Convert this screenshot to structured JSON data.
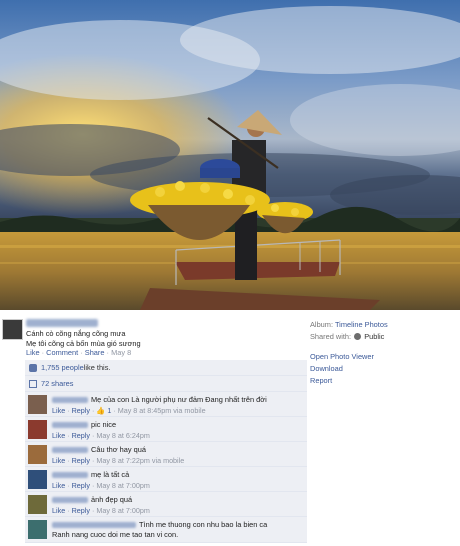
{
  "post": {
    "caption_lines": [
      "Cánh cò cõng nắng cõng mưa",
      "Mẹ tôi cõng cả bốn mùa gió sương"
    ],
    "actions": {
      "like": "Like",
      "comment": "Comment",
      "share": "Share",
      "date": "May 8"
    },
    "likes_text": "1,755 people",
    "likes_suffix": " like this.",
    "shares_text": "72 shares"
  },
  "sidebar": {
    "album_label": "Album:",
    "album_value": "Timeline Photos",
    "shared_label": "Shared with:",
    "shared_value": "Public",
    "menu": [
      "Open Photo Viewer",
      "Download",
      "Report"
    ]
  },
  "comments": [
    {
      "text": "Mẹ của con Là người phụ nư đảm Đang nhất trên đời",
      "like": "Like",
      "reply": "Reply",
      "likes": "1",
      "meta": "May 8 at 8:45pm via mobile",
      "avatar_color": "#7a5f4e"
    },
    {
      "text": "pic nice",
      "like": "Like",
      "reply": "Reply",
      "meta": "May 8 at 6:24pm",
      "avatar_color": "#8b3a2e"
    },
    {
      "text": "Câu thơ hay quá",
      "like": "Like",
      "reply": "Reply",
      "meta": "May 8 at 7:22pm via mobile",
      "avatar_color": "#9b6b3c"
    },
    {
      "text": "mẹ là tất cả",
      "like": "Like",
      "reply": "Reply",
      "meta": "May 8 at 7:00pm",
      "avatar_color": "#2f4f7a"
    },
    {
      "text": "ảnh đẹp quá",
      "like": "Like",
      "reply": "Reply",
      "meta": "May 8 at 7:00pm",
      "avatar_color": "#6e6a3a"
    },
    {
      "text": "Tình me thuong con nhu bao la bien ca",
      "text2": "Ranh nang cuoc doi me tao tan vi con.",
      "avatar_color": "#3c6e6e"
    }
  ]
}
